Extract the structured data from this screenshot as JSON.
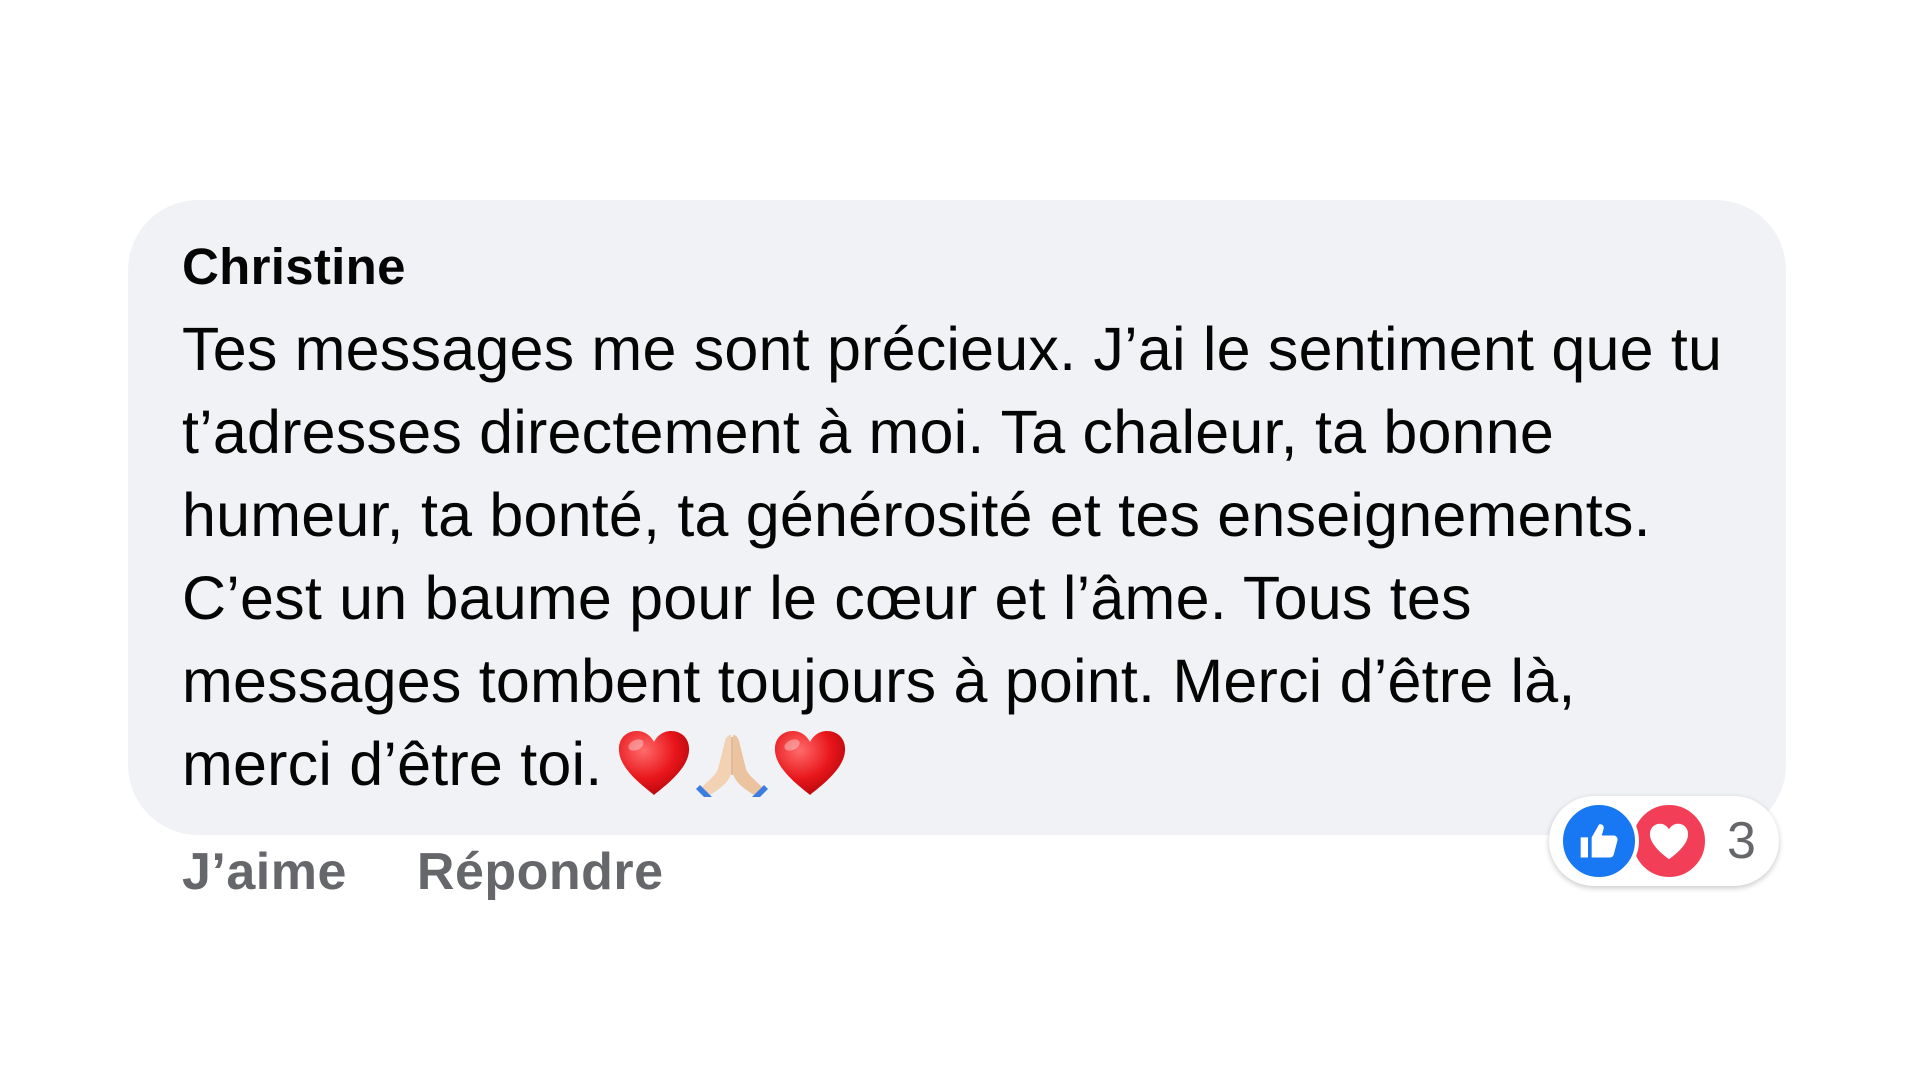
{
  "comment": {
    "author": "Christine",
    "text": "Tes messages me sont précieux. J’ai le sentiment que tu t’adresses directement à moi. Ta chaleur, ta bonne humeur, ta bonté, ta générosité et tes enseignements. C’est un baume pour le cœur et l’âme. Tous tes messages tombent toujours à point. Merci d’être là, merci d’être toi.",
    "emojis": [
      "heart-emoji",
      "folded-hands-emoji",
      "heart-emoji"
    ]
  },
  "actions": {
    "like_label": "J’aime",
    "reply_label": "Répondre"
  },
  "reactions": {
    "icons": [
      "thumbs-up-icon",
      "heart-icon"
    ],
    "count": "3"
  },
  "colors": {
    "bubble_background": "#f0f2f5",
    "text": "#050505",
    "secondary_text": "#65676b",
    "like_blue": "#1877f2",
    "love_red": "#f33e58"
  }
}
